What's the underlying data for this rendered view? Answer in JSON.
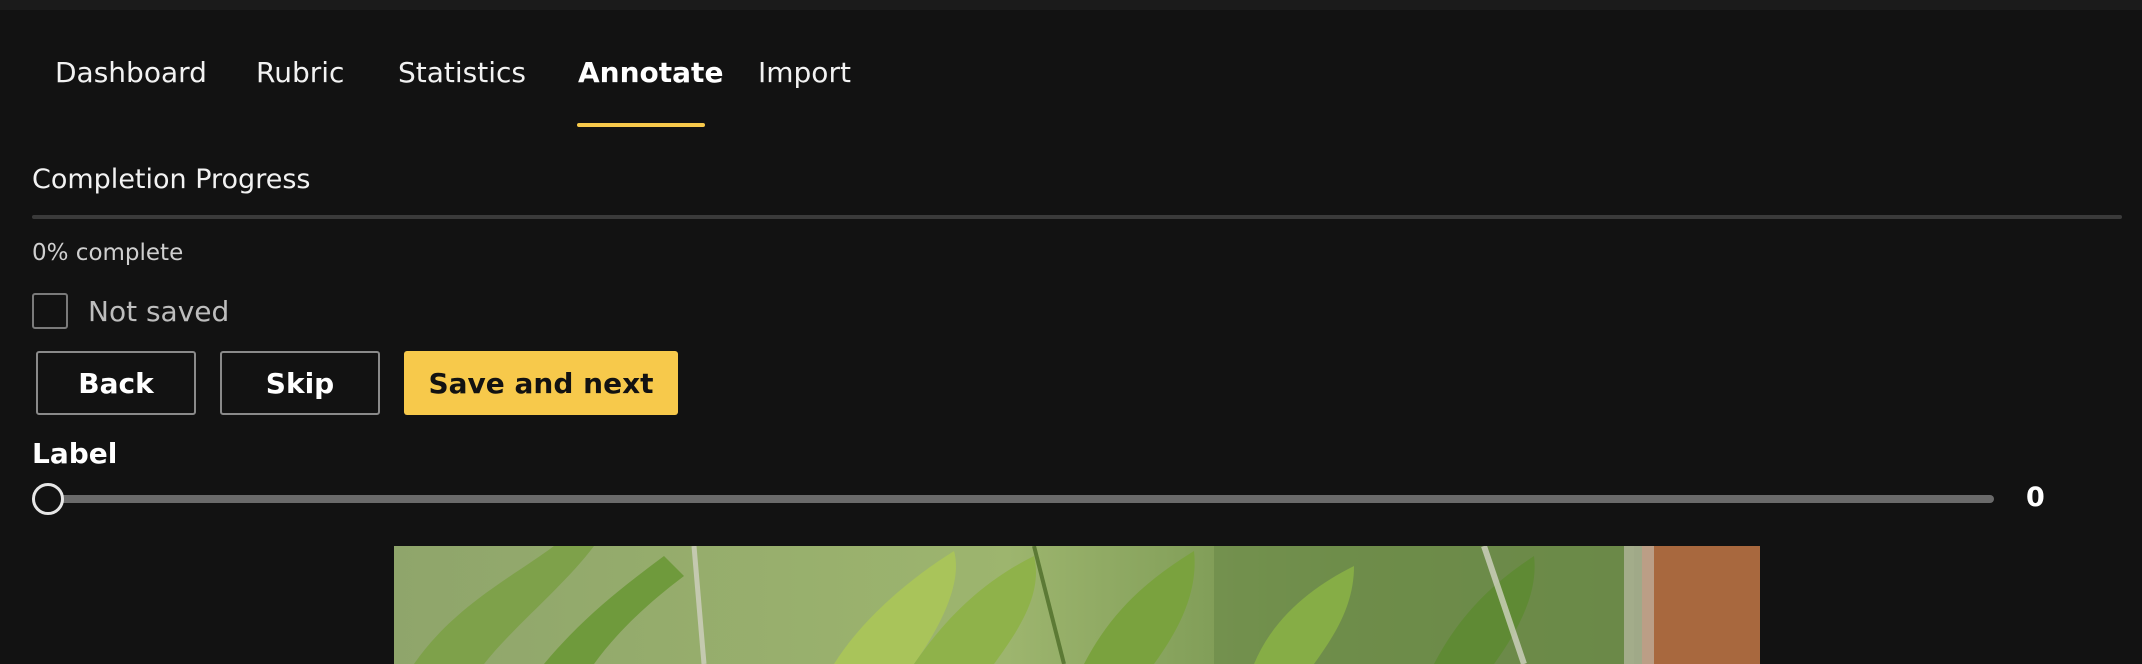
{
  "nav": {
    "tabs": [
      {
        "label": "Dashboard",
        "active": false
      },
      {
        "label": "Rubric",
        "active": false
      },
      {
        "label": "Statistics",
        "active": false
      },
      {
        "label": "Annotate",
        "active": true
      },
      {
        "label": "Import",
        "active": false
      }
    ]
  },
  "progress": {
    "title": "Completion Progress",
    "text": "0% complete",
    "fraction": 0
  },
  "save_status": {
    "label": "Not saved",
    "checked": false
  },
  "actions": {
    "back_label": "Back",
    "skip_label": "Skip",
    "save_next_label": "Save and next"
  },
  "label_control": {
    "title": "Label",
    "value": "0"
  },
  "colors": {
    "accent": "#f7c94b",
    "background": "#121212"
  },
  "image": {
    "subject": "green leaves on a branch"
  }
}
